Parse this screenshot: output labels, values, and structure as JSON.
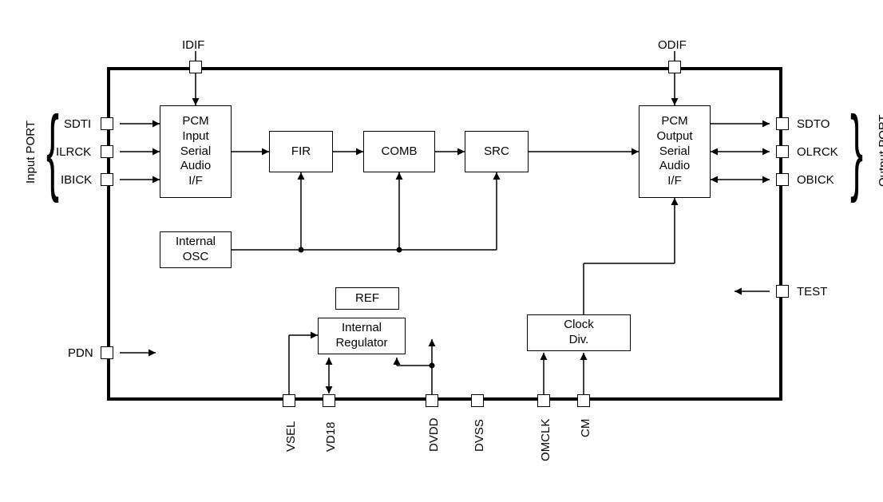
{
  "pins": {
    "top": {
      "idif": "IDIF",
      "odif": "ODIF"
    },
    "left": {
      "sdti": "SDTI",
      "ilrck": "ILRCK",
      "ibick": "IBICK",
      "pdn": "PDN"
    },
    "right": {
      "sdto": "SDTO",
      "olrck": "OLRCK",
      "obick": "OBICK",
      "test": "TEST"
    },
    "bottom": {
      "vsel": "VSEL",
      "vd18": "VD18",
      "dvdd": "DVDD",
      "dvss": "DVSS",
      "omclk": "OMCLK",
      "cm": "CM"
    }
  },
  "blocks": {
    "pcm_in": "PCM\nInput\nSerial\nAudio\nI/F",
    "fir": "FIR",
    "comb": "COMB",
    "src": "SRC",
    "pcm_out": "PCM\nOutput\nSerial\nAudio\nI/F",
    "internal_osc": "Internal\nOSC",
    "ref": "REF",
    "internal_reg": "Internal\nRegulator",
    "clock_div": "Clock\nDiv."
  },
  "port_labels": {
    "input_port": "Input PORT",
    "output_port": "Output PORT"
  }
}
